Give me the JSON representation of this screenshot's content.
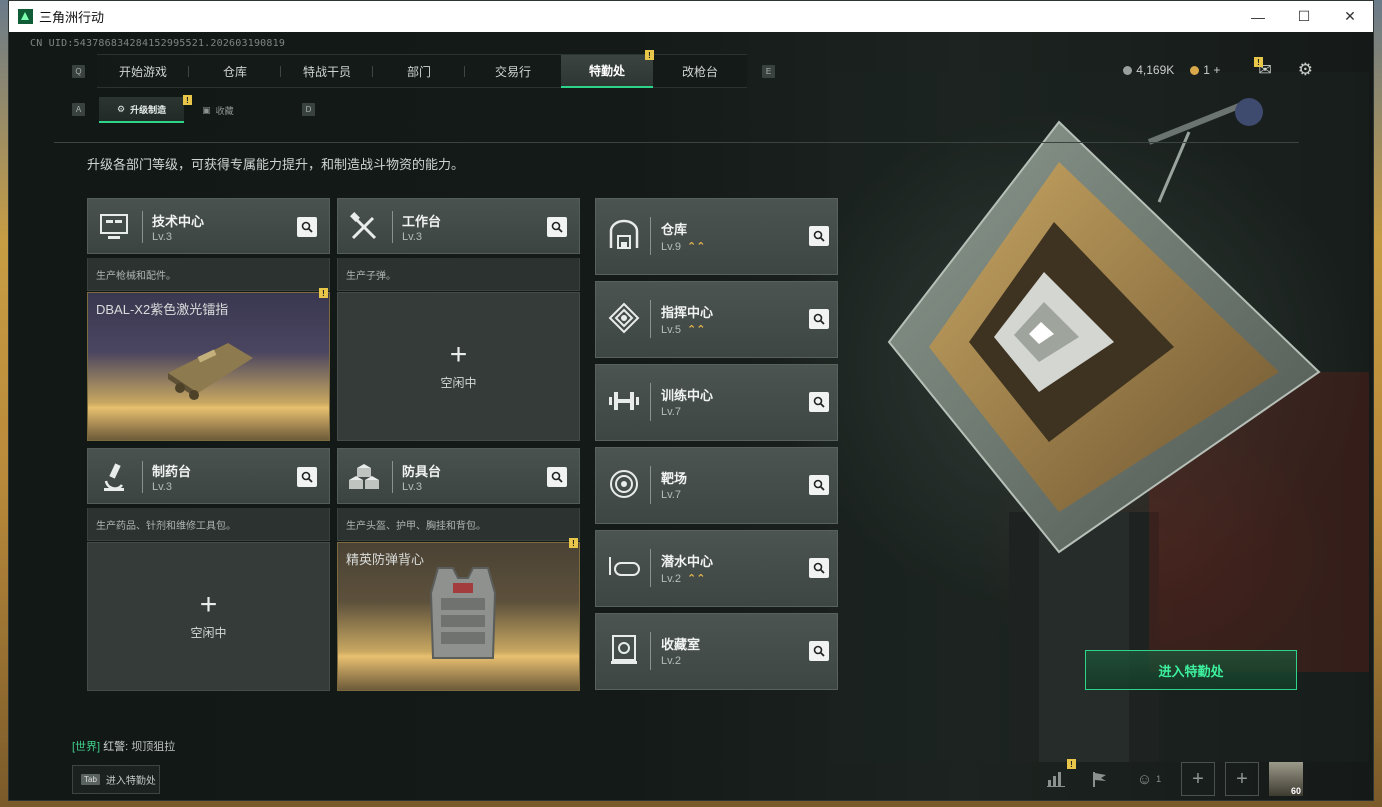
{
  "window": {
    "title": "三角洲行动"
  },
  "uid": "CN UID:543786834284152995521.202603190819",
  "nav": {
    "left_key": "Q",
    "right_key": "E",
    "items": [
      {
        "label": "开始游戏"
      },
      {
        "label": "仓库"
      },
      {
        "label": "特战干员"
      },
      {
        "label": "部门"
      },
      {
        "label": "交易行"
      },
      {
        "label": "特勤处"
      },
      {
        "label": "改枪台"
      }
    ],
    "active": "特勤处"
  },
  "subnav": {
    "left_key": "A",
    "right_key": "D",
    "tabs": [
      {
        "label": "升级制造"
      },
      {
        "label": "收藏"
      }
    ]
  },
  "currency": {
    "coins": "4,169K",
    "tickets": "1",
    "plus": "+"
  },
  "badge_mark": "!",
  "description": "升级各部门等级，可获得专属能力提升，和制造战斗物资的能力。",
  "left_cards": [
    {
      "name": "技术中心",
      "level": "Lv.3",
      "sub": "生产枪械和配件。",
      "product": "DBAL-X2紫色激光镭指"
    },
    {
      "name": "工作台",
      "level": "Lv.3",
      "sub": "生产子弹。",
      "idle_plus": "+",
      "idle": "空闲中"
    },
    {
      "name": "制药台",
      "level": "Lv.3",
      "sub": "生产药品、针剂和维修工具包。",
      "idle_plus": "+",
      "idle": "空闲中"
    },
    {
      "name": "防具台",
      "level": "Lv.3",
      "sub": "生产头盔、护甲、胸挂和背包。",
      "product": "精英防弹背心"
    }
  ],
  "right_cards": [
    {
      "name": "仓库",
      "level": "Lv.9",
      "upgrade": "⌃⌃"
    },
    {
      "name": "指挥中心",
      "level": "Lv.5",
      "upgrade": "⌃⌃"
    },
    {
      "name": "训练中心",
      "level": "Lv.7"
    },
    {
      "name": "靶场",
      "level": "Lv.7"
    },
    {
      "name": "潜水中心",
      "level": "Lv.2",
      "upgrade": "⌃⌃"
    },
    {
      "name": "收藏室",
      "level": "Lv.2"
    }
  ],
  "enter_button": "进入特勤处",
  "chat": {
    "channel": "[世界]",
    "user": "红警:",
    "message": "坝顶狙拉"
  },
  "tab_hint": {
    "key": "Tab",
    "label": "进入特勤处"
  },
  "bottom": {
    "friends_count": "1",
    "avatar_level": "60"
  },
  "colors": {
    "accent": "#2fd48b",
    "badge": "#e8c64a",
    "upgrade": "#e8b84a"
  }
}
